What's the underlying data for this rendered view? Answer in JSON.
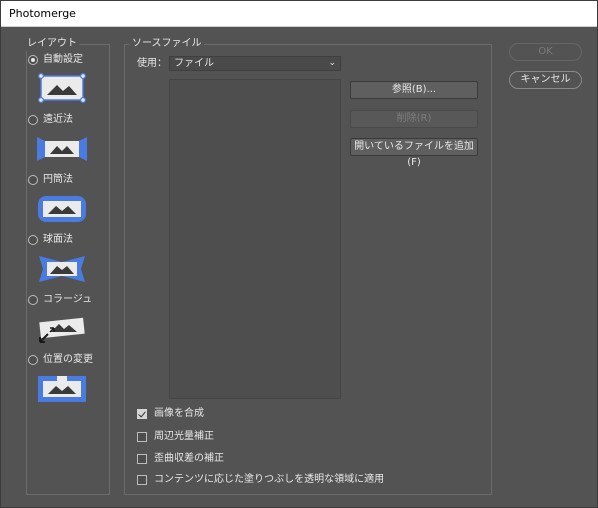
{
  "window": {
    "title": "Photomerge"
  },
  "layout": {
    "title": "レイアウト",
    "options": [
      {
        "label": "自動設定",
        "checked": true,
        "icon": "auto-layout-icon"
      },
      {
        "label": "遠近法",
        "checked": false,
        "icon": "perspective-layout-icon"
      },
      {
        "label": "円筒法",
        "checked": false,
        "icon": "cylindrical-layout-icon"
      },
      {
        "label": "球面法",
        "checked": false,
        "icon": "spherical-layout-icon"
      },
      {
        "label": "コラージュ",
        "checked": false,
        "icon": "collage-layout-icon"
      },
      {
        "label": "位置の変更",
        "checked": false,
        "icon": "reposition-layout-icon"
      }
    ]
  },
  "source": {
    "title": "ソースファイル",
    "use_label": "使用：",
    "use_value": "ファイル",
    "files": [],
    "browse_label": "参照(B)...",
    "remove_label": "削除(R)",
    "add_open_label": "開いているファイルを追加(F)"
  },
  "options": [
    {
      "label": "画像を合成",
      "checked": true
    },
    {
      "label": "周辺光量補正",
      "checked": false
    },
    {
      "label": "歪曲収差の補正",
      "checked": false
    },
    {
      "label": "コンテンツに応じた塗りつぶしを透明な領域に適用",
      "checked": false
    }
  ],
  "dialog_buttons": {
    "ok_label": "OK",
    "cancel_label": "キャンセル"
  },
  "colors": {
    "accent": "#4a7be0",
    "icon_fill": "#ebebeb",
    "background": "#535353"
  }
}
